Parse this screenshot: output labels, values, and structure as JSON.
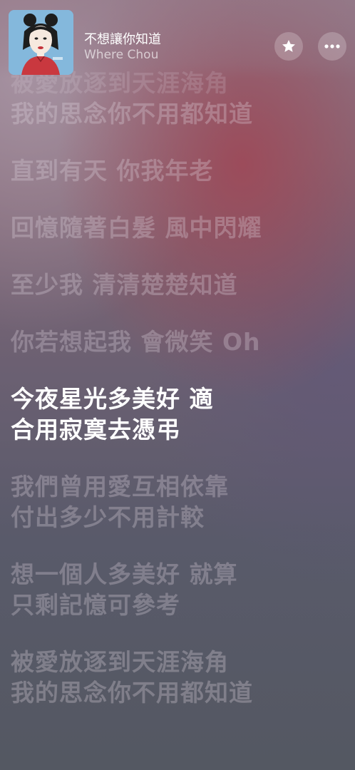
{
  "now_playing": {
    "title": "不想讓你知道",
    "artist": "Where Chou",
    "favorite_icon": "star-icon",
    "more_icon": "ellipsis-icon"
  },
  "lyrics": [
    {
      "lines": [
        "被愛放逐到天涯海角",
        "我的思念你不用都知道"
      ],
      "active": false
    },
    {
      "lines": [
        "直到有天 你我年老"
      ],
      "active": false
    },
    {
      "lines": [
        "回憶隨著白髮 風中閃耀"
      ],
      "active": false
    },
    {
      "lines": [
        "至少我 清清楚楚知道"
      ],
      "active": false
    },
    {
      "lines": [
        "你若想起我 會微笑 Oh"
      ],
      "active": false
    },
    {
      "lines": [
        "今夜星光多美好 適",
        "合用寂寞去憑弔"
      ],
      "active": true
    },
    {
      "lines": [
        "我們曾用愛互相依靠",
        "付出多少不用計較"
      ],
      "active": false
    },
    {
      "lines": [
        "想一個人多美好 就算",
        "只剩記憶可參考"
      ],
      "active": false
    },
    {
      "lines": [
        "被愛放逐到天涯海角",
        "我的思念你不用都知道"
      ],
      "active": false
    }
  ]
}
